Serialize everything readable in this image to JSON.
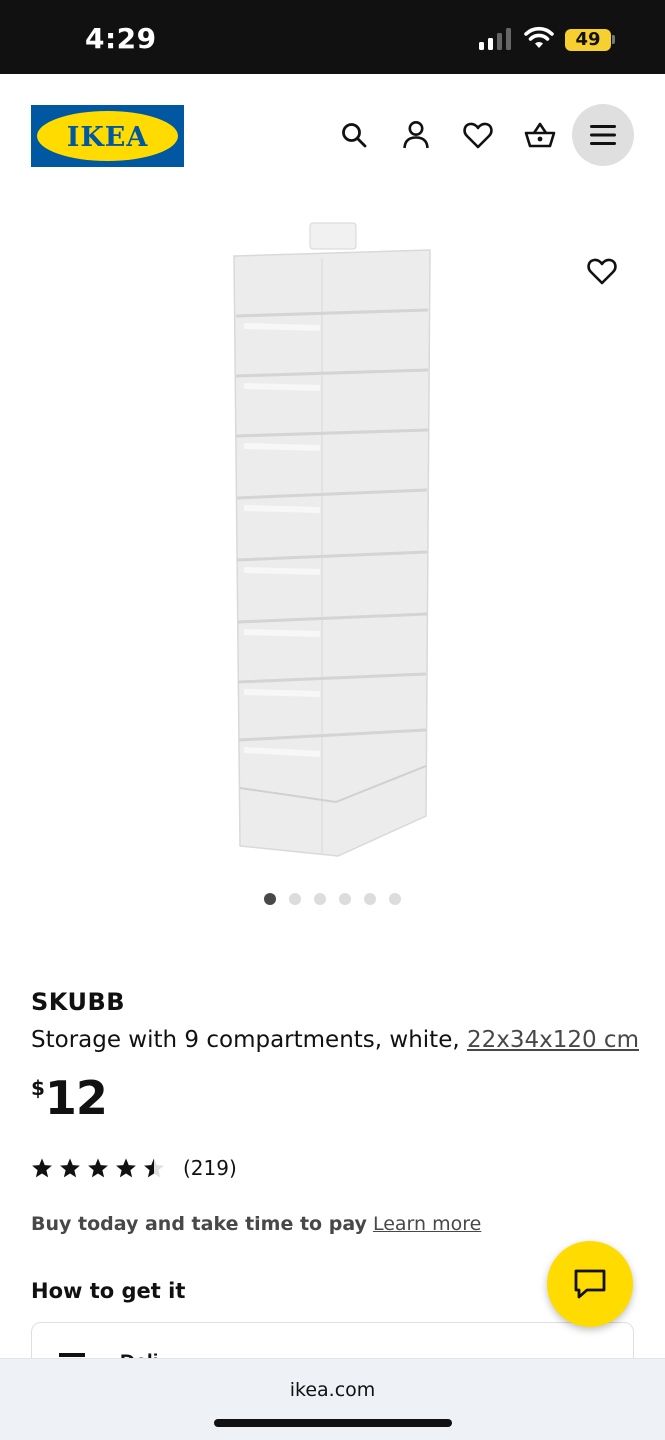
{
  "status_bar": {
    "time": "4:29",
    "battery": "49"
  },
  "header": {
    "logo_text": "IKEA",
    "icons": [
      "search-icon",
      "account-icon",
      "heart-icon",
      "basket-icon",
      "menu-icon"
    ]
  },
  "gallery": {
    "image_count": 6,
    "active_index": 0
  },
  "product": {
    "name": "SKUBB",
    "description": "Storage with 9 compartments, white, ",
    "dimensions": "22x34x120 cm",
    "currency": "$",
    "price": "12",
    "rating": 4.5,
    "review_count": "(219)"
  },
  "payment": {
    "text": "Buy today and take time to pay",
    "link": "Learn more"
  },
  "how_to_get": {
    "title": "How to get it",
    "delivery_label": "Deli"
  },
  "colors": {
    "ikea_blue": "#0058a3",
    "ikea_yellow": "#ffdb00"
  },
  "browser": {
    "url": "ikea.com"
  }
}
